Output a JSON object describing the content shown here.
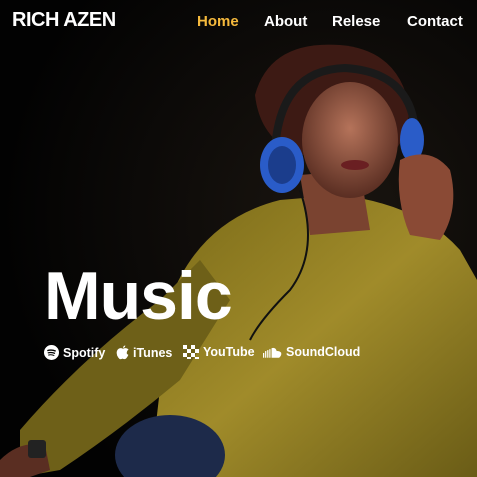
{
  "brand": {
    "logo_text": "RICH AZEN"
  },
  "nav": {
    "items": [
      {
        "label": "Home",
        "active": true
      },
      {
        "label": "About",
        "active": false
      },
      {
        "label": "Relese",
        "active": false
      },
      {
        "label": "Contact",
        "active": false
      }
    ]
  },
  "hero": {
    "title": "Music",
    "platforms": [
      {
        "label": "Spotify",
        "icon": "spotify-icon"
      },
      {
        "label": "iTunes",
        "icon": "apple-icon"
      },
      {
        "label": "YouTube",
        "icon": "youtube-icon"
      },
      {
        "label": "SoundCloud",
        "icon": "soundcloud-icon"
      }
    ]
  },
  "colors": {
    "accent": "#f5b93c",
    "text": "#ffffff",
    "background": "#050505",
    "shirt": "#8a7a1e"
  }
}
